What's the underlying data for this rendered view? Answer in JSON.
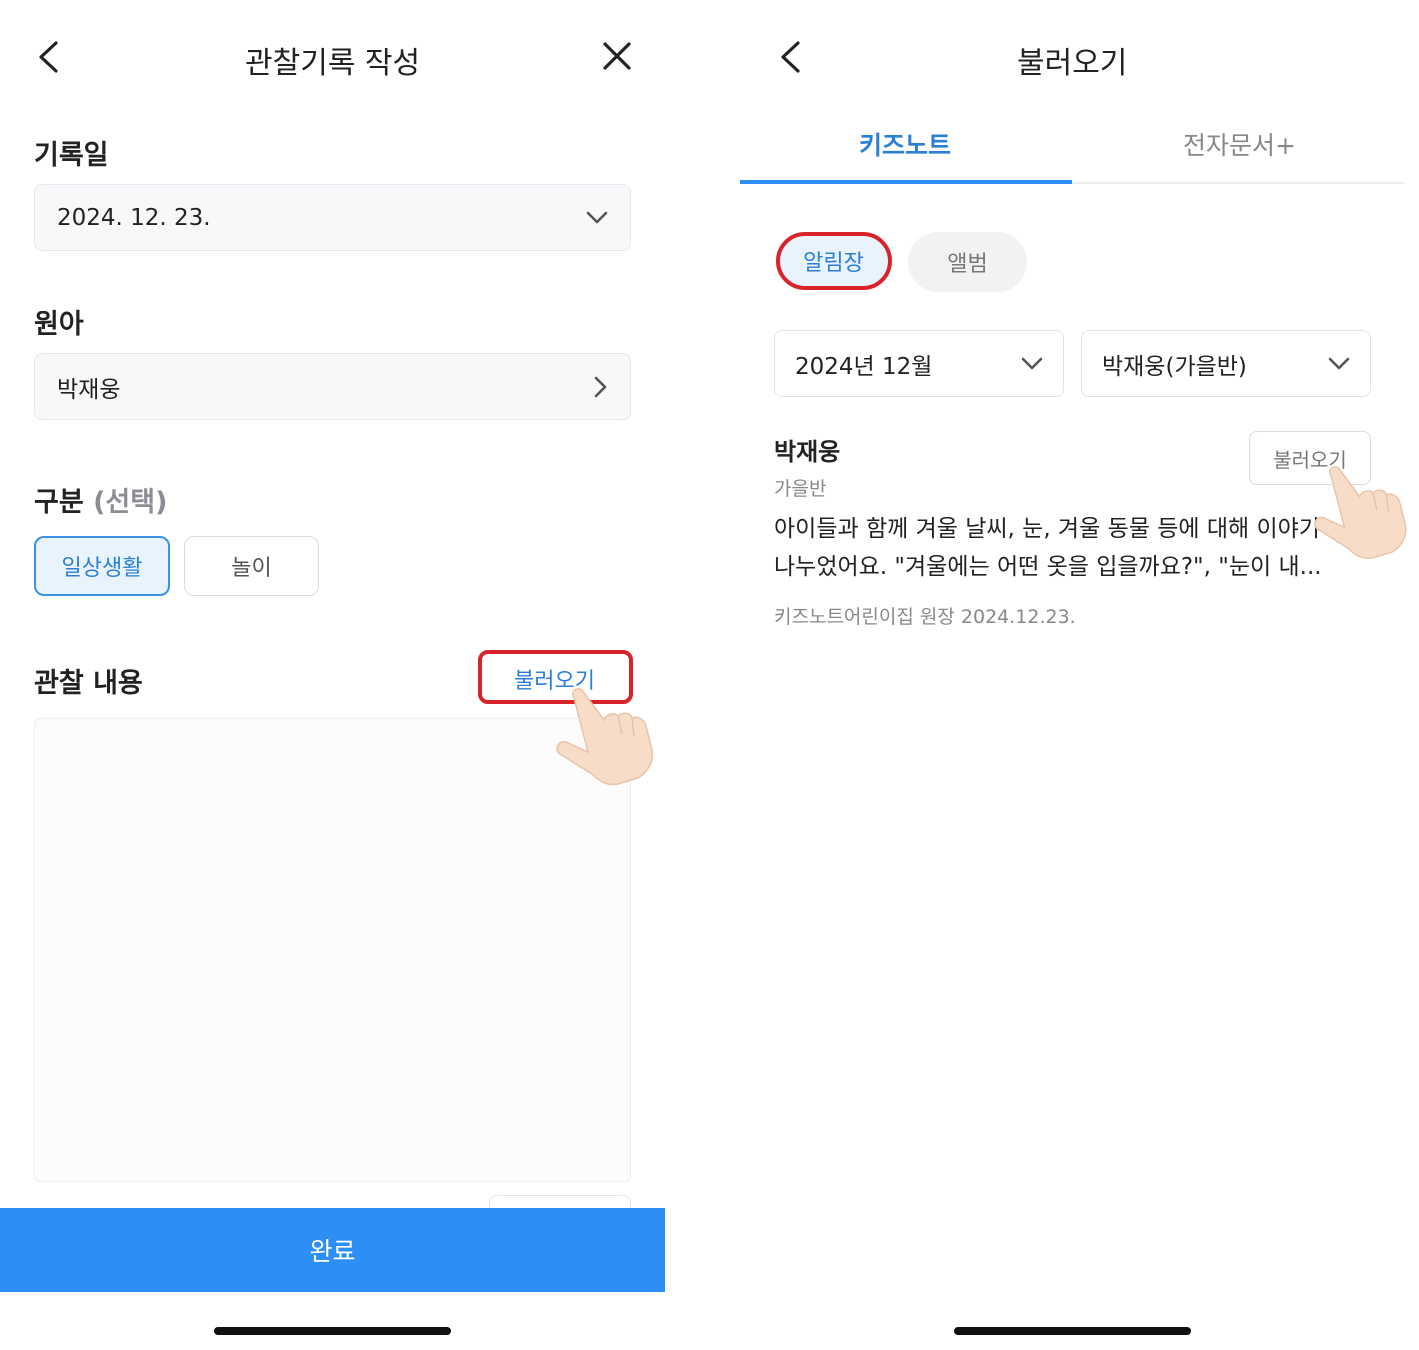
{
  "left": {
    "header": {
      "title": "관찰기록 작성"
    },
    "date": {
      "label": "기록일",
      "value": "2024. 12. 23."
    },
    "child": {
      "label": "원아",
      "value": "박재웅"
    },
    "category": {
      "label": "구분",
      "label_optional": "(선택)",
      "options": [
        "일상생활",
        "놀이"
      ],
      "selected": "일상생활"
    },
    "content": {
      "label": "관찰 내용",
      "load_button": "불러오기",
      "placeholder": ""
    },
    "submit": {
      "label": "완료"
    }
  },
  "right": {
    "header": {
      "title": "불러오기"
    },
    "tabs": [
      {
        "label": "키즈노트",
        "active": true
      },
      {
        "label": "전자문서+",
        "active": false
      }
    ],
    "filters": {
      "options": [
        "알림장",
        "앨범"
      ],
      "selected": "알림장"
    },
    "month_select": {
      "value": "2024년 12월"
    },
    "child_select": {
      "value": "박재웅(가을반)"
    },
    "entry": {
      "name": "박재웅",
      "class": "가을반",
      "load_button": "불러오기",
      "line1": "아이들과 함께 겨울 날씨, 눈, 겨울 동물 등에 대해 이야기",
      "line2": "나누었어요. \"겨울에는 어떤 옷을 입을까요?\", \"눈이 내...",
      "author": "키즈노트어린이집 원장",
      "date": "2024.12.23."
    }
  },
  "colors": {
    "accent": "#2d8ff5",
    "highlight": "#d9232a",
    "chip_bg": "#e8f3fd"
  }
}
